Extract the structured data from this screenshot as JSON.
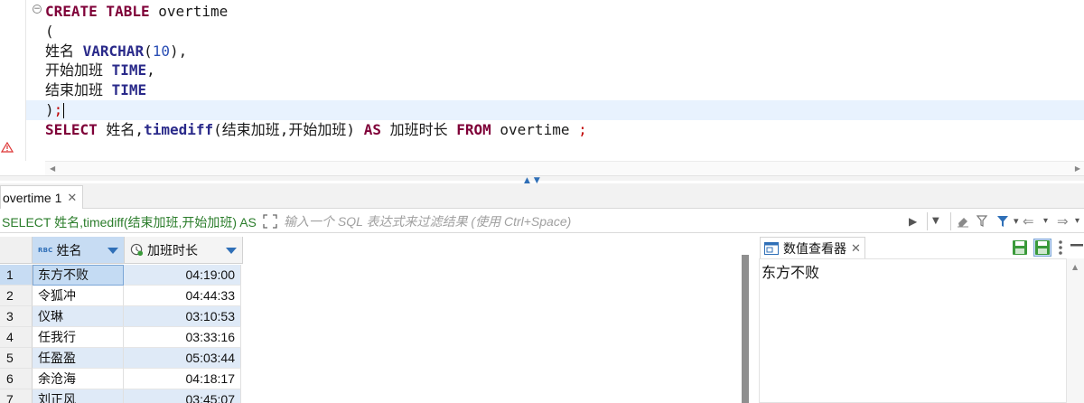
{
  "editor": {
    "lines": [
      {
        "tokens": [
          {
            "t": "CREATE TABLE",
            "c": "kw"
          },
          {
            "t": " overtime",
            "c": ""
          }
        ]
      },
      {
        "tokens": [
          {
            "t": "(",
            "c": ""
          }
        ]
      },
      {
        "tokens": [
          {
            "t": "姓名 ",
            "c": ""
          },
          {
            "t": "VARCHAR",
            "c": "kw-dark"
          },
          {
            "t": "(",
            "c": ""
          },
          {
            "t": "10",
            "c": "num"
          },
          {
            "t": "),",
            "c": ""
          }
        ]
      },
      {
        "tokens": [
          {
            "t": "开始加班 ",
            "c": ""
          },
          {
            "t": "TIME",
            "c": "kw-dark"
          },
          {
            "t": ",",
            "c": ""
          }
        ]
      },
      {
        "tokens": [
          {
            "t": "结束加班 ",
            "c": ""
          },
          {
            "t": "TIME",
            "c": "kw-dark"
          }
        ]
      },
      {
        "tokens": [
          {
            "t": ")",
            "c": ""
          },
          {
            "t": ";",
            "c": "semi"
          }
        ],
        "current": true
      },
      {
        "tokens": [
          {
            "t": "SELECT",
            "c": "kw"
          },
          {
            "t": " 姓名,",
            "c": ""
          },
          {
            "t": "timediff",
            "c": "kw-dark"
          },
          {
            "t": "(结束加班,开始加班) ",
            "c": ""
          },
          {
            "t": "AS",
            "c": "kw"
          },
          {
            "t": " 加班时长 ",
            "c": ""
          },
          {
            "t": "FROM",
            "c": "kw"
          },
          {
            "t": " overtime ",
            "c": ""
          },
          {
            "t": ";",
            "c": "semi"
          }
        ]
      }
    ]
  },
  "result_tab": {
    "label": "overtime 1"
  },
  "filter": {
    "sql_text": "SELECT 姓名,timediff(结束加班,开始加班) AS",
    "placeholder": "输入一个 SQL 表达式来过滤结果 (使用 Ctrl+Space)"
  },
  "grid": {
    "columns": [
      {
        "name": "姓名",
        "type_icon": "abc-text-icon"
      },
      {
        "name": "加班时长",
        "type_icon": "clock-icon"
      }
    ],
    "rows": [
      {
        "num": "1",
        "name": "东方不败",
        "duration": "04:19:00"
      },
      {
        "num": "2",
        "name": "令狐冲",
        "duration": "04:44:33"
      },
      {
        "num": "3",
        "name": "仪琳",
        "duration": "03:10:53"
      },
      {
        "num": "4",
        "name": "任我行",
        "duration": "03:33:16"
      },
      {
        "num": "5",
        "name": "任盈盈",
        "duration": "05:03:44"
      },
      {
        "num": "6",
        "name": "余沧海",
        "duration": "04:18:17"
      },
      {
        "num": "7",
        "name": "刘正风",
        "duration": "03:45:07"
      }
    ]
  },
  "viewer": {
    "title": "数值查看器",
    "value": "东方不败"
  },
  "colors": {
    "keyword": "#7f0038",
    "keyword_dark": "#2a2a8a",
    "number": "#2b4fb5",
    "filter_sql": "#2b7d2b",
    "selection": "#c7dcf3",
    "accent": "#2f6fb7"
  }
}
